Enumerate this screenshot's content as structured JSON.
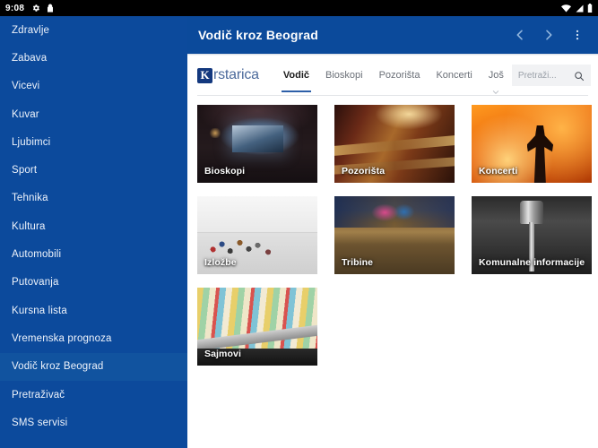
{
  "statusbar": {
    "clock": "9:08",
    "icons_left": [
      "gear-icon",
      "lock-icon"
    ],
    "icons_right": [
      "wifi-icon",
      "signal-icon",
      "battery-icon"
    ]
  },
  "sidebar": {
    "background": "#0C4A9C",
    "selected_background": "#11539F",
    "items": [
      {
        "label": "Zdravlje",
        "selected": false
      },
      {
        "label": "Zabava",
        "selected": false
      },
      {
        "label": "Vicevi",
        "selected": false
      },
      {
        "label": "Kuvar",
        "selected": false
      },
      {
        "label": "Ljubimci",
        "selected": false
      },
      {
        "label": "Sport",
        "selected": false
      },
      {
        "label": "Tehnika",
        "selected": false
      },
      {
        "label": "Kultura",
        "selected": false
      },
      {
        "label": "Automobili",
        "selected": false
      },
      {
        "label": "Putovanja",
        "selected": false
      },
      {
        "label": "Kursna lista",
        "selected": false
      },
      {
        "label": "Vremenska prognoza",
        "selected": false
      },
      {
        "label": "Vodič kroz Beograd",
        "selected": true
      },
      {
        "label": "Pretraživač",
        "selected": false
      },
      {
        "label": "SMS servisi",
        "selected": false
      }
    ]
  },
  "appbar": {
    "title": "Vodič kroz Beograd",
    "background": "#0B4A9B",
    "actions": [
      {
        "name": "back-icon"
      },
      {
        "name": "forward-icon"
      },
      {
        "name": "overflow-menu-icon"
      }
    ]
  },
  "site": {
    "logo": {
      "badge": "K",
      "text": "rstarica",
      "badge_color": "#13387E",
      "text_color": "#4C6A9B"
    },
    "tabs": [
      {
        "label": "Vodič",
        "active": true,
        "has_caret": false
      },
      {
        "label": "Bioskopi",
        "active": false,
        "has_caret": false
      },
      {
        "label": "Pozorišta",
        "active": false,
        "has_caret": false
      },
      {
        "label": "Koncerti",
        "active": false,
        "has_caret": false
      },
      {
        "label": "Još",
        "active": false,
        "has_caret": true
      }
    ],
    "active_tab_underline_color": "#2D5FA8",
    "search": {
      "placeholder": "Pretraži...",
      "value": "",
      "icon": "search-icon"
    }
  },
  "cards": [
    {
      "label": "Bioskopi",
      "art": "art-cinema"
    },
    {
      "label": "Pozorišta",
      "art": "art-theater"
    },
    {
      "label": "Koncerti",
      "art": "art-concert"
    },
    {
      "label": "Izložbe",
      "art": "art-gallery"
    },
    {
      "label": "Tribine",
      "art": "art-audience"
    },
    {
      "label": "Komunalne informacije",
      "art": "art-faucet"
    },
    {
      "label": "Sajmovi",
      "art": "art-fair"
    }
  ]
}
